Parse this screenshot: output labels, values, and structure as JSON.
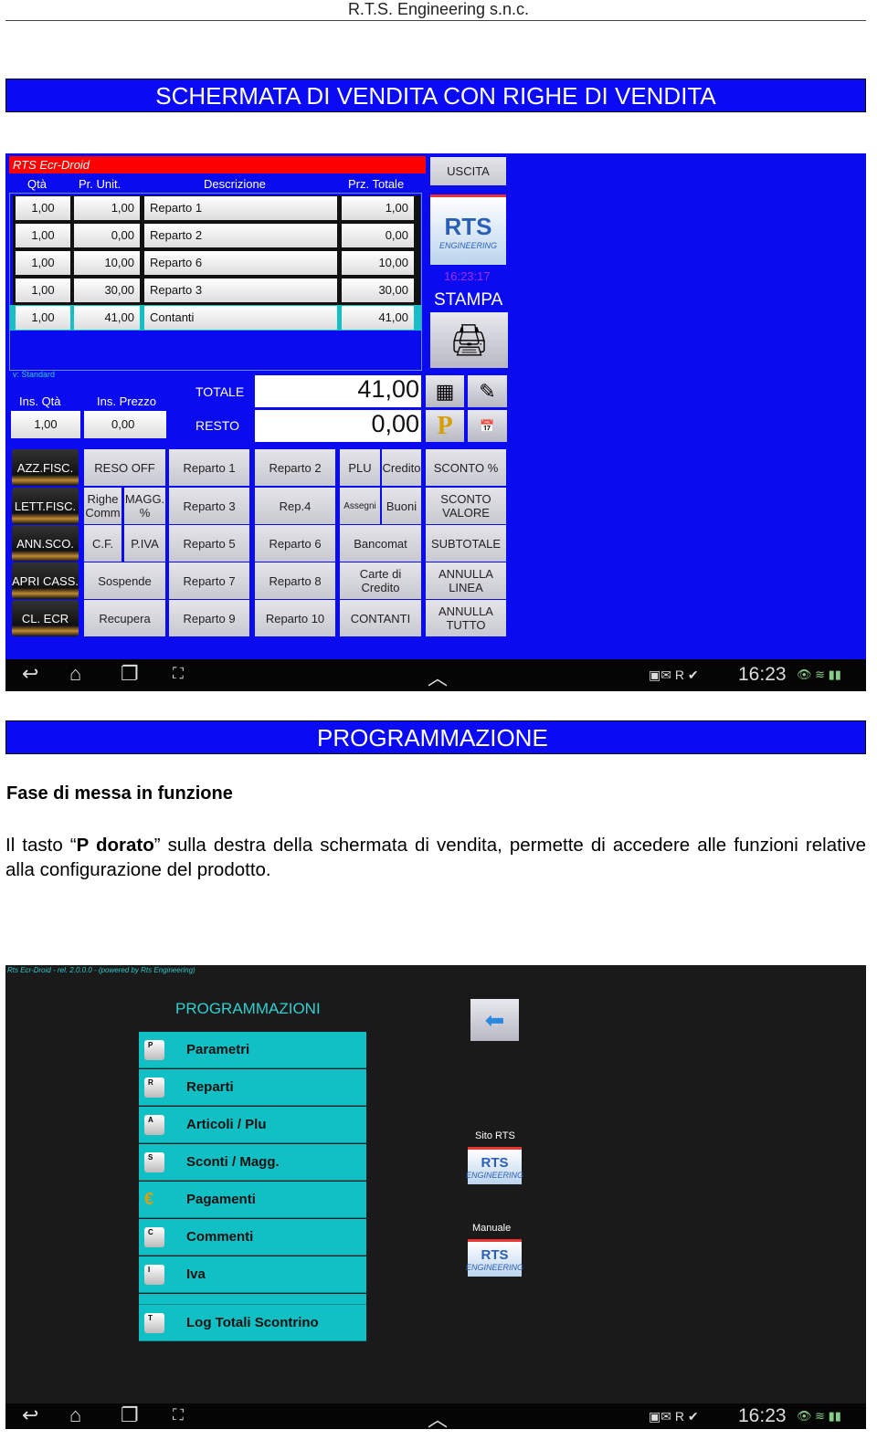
{
  "page_header": "R.T.S. Engineering s.n.c.",
  "section1_title": "SCHERMATA DI VENDITA CON RIGHE DI VENDITA",
  "sales_screen": {
    "app_title": "RTS  Ecr-Droid",
    "columns": [
      "Qtà",
      "Pr. Unit.",
      "Descrizione",
      "Prz. Totale"
    ],
    "rows": [
      [
        "1,00",
        "1,00",
        "Reparto 1",
        "1,00"
      ],
      [
        "1,00",
        "0,00",
        "Reparto 2",
        "0,00"
      ],
      [
        "1,00",
        "10,00",
        "Reparto 6",
        "10,00"
      ],
      [
        "1,00",
        "30,00",
        "Reparto 3",
        "30,00"
      ],
      [
        "1,00",
        "41,00",
        "Contanti",
        "41,00"
      ]
    ],
    "exit_label": "USCITA",
    "logo_text": "ENGINEERING",
    "clock": "16:23:17",
    "print_label": "STAMPA",
    "version_label": "v:  Standard",
    "ins_qty_label": "Ins. Qtà",
    "ins_price_label": "Ins. Prezzo",
    "ins_qty_value": "1,00",
    "ins_price_value": "0,00",
    "total_label": "TOTALE",
    "total_value": "41,00",
    "change_label": "RESTO",
    "change_value": "0,00",
    "left_buttons": [
      "AZZ.FISC.",
      "LETT.FISC.",
      "ANN.SCO.",
      "APRI CASS.",
      "CL. ECR"
    ],
    "keys": [
      [
        "RESO OFF",
        "Reparto 1",
        "Reparto 2",
        "PLU",
        "Credito",
        "SCONTO %"
      ],
      [
        "Righe Comm",
        "MAGG. %",
        "Reparto 3",
        "Rep.4",
        "Assegni",
        "Buoni",
        "SCONTO VALORE"
      ],
      [
        "C.F.",
        "P.IVA",
        "Reparto 5",
        "Reparto 6",
        "Bancomat",
        "SUBTOTALE"
      ],
      [
        "Sospende",
        "Reparto 7",
        "Reparto 8",
        "Carte di Credito",
        "ANNULLA LINEA"
      ],
      [
        "Recupera",
        "Reparto 9",
        "Reparto 10",
        "CONTANTI",
        "ANNULLA TUTTO"
      ]
    ],
    "accent_color": "#0b0bf0",
    "title_bar_color": "#ff0000"
  },
  "status_bar": {
    "time": "16:23"
  },
  "section2_title": "PROGRAMMAZIONE",
  "subheading": "Fase di messa in funzione",
  "paragraph_parts": [
    "Il tasto “",
    "P dorato",
    "” sulla destra della schermata di vendita, permette di accedere alle funzioni relative alla configurazione del prodotto."
  ],
  "prog_screen": {
    "top_line": "Rts Ecr-Droid  -  rel. 2.0.0.0  - (powered by Rts Engineering)",
    "title": "PROGRAMMAZIONI",
    "menu": [
      {
        "key": "P",
        "label": "Parametri"
      },
      {
        "key": "R",
        "label": "Reparti"
      },
      {
        "key": "A",
        "label": "Articoli / Plu"
      },
      {
        "key": "S",
        "label": "Sconti / Magg."
      },
      {
        "key": "€",
        "label": "Pagamenti"
      },
      {
        "key": "C",
        "label": "Commenti"
      },
      {
        "key": "I",
        "label": "Iva"
      },
      {
        "key": "T",
        "label": "Log Totali Scontrino"
      }
    ],
    "site_label": "Sito RTS",
    "manual_label": "Manuale"
  }
}
